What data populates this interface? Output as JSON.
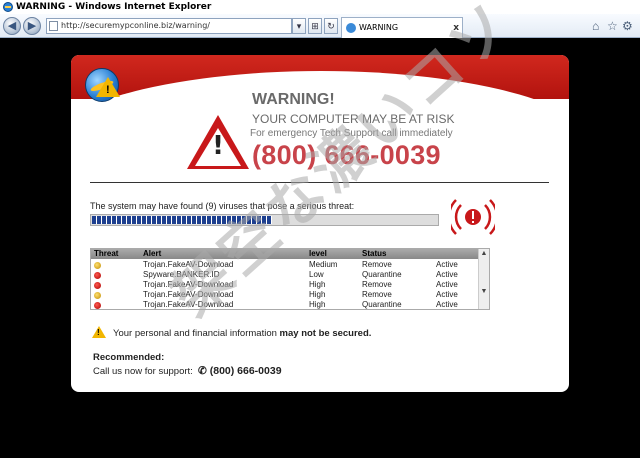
{
  "window": {
    "title": "WARNING - Windows Internet Explorer"
  },
  "toolbar": {
    "address": "http://securemypconline.biz/warning/",
    "tab_label": "WARNING",
    "back_icon": "back-arrow-icon",
    "forward_icon": "forward-arrow-icon"
  },
  "warning": {
    "title": "WARNING!",
    "subtitle": "YOUR COMPUTER MAY BE AT RISK",
    "call_text": "For emergency Tech Support call immediately",
    "phone": "(800) 666-0039"
  },
  "scan": {
    "message": "The system may have found (9) viruses that pose a serious threat:",
    "progress_fraction": 0.52
  },
  "threat_table": {
    "headers": [
      "Threat",
      "Alert",
      "level",
      "Status",
      ""
    ],
    "rows": [
      {
        "icon": "yellow",
        "alert": "Trojan.FakeAV-Download",
        "level": "Medium",
        "status": "Remove",
        "state": "Active"
      },
      {
        "icon": "red",
        "alert": "Spyware.BANKER.ID",
        "level": "Low",
        "status": "Quarantine",
        "state": "Active"
      },
      {
        "icon": "red",
        "alert": "Trojan.FakeAV-Download",
        "level": "High",
        "status": "Remove",
        "state": "Active"
      },
      {
        "icon": "yellow",
        "alert": "Trojan.FakeAV-Download",
        "level": "High",
        "status": "Remove",
        "state": "Active"
      },
      {
        "icon": "red",
        "alert": "Trojan.FakeAV-Download",
        "level": "High",
        "status": "Quarantine",
        "state": "Active"
      }
    ]
  },
  "note": {
    "text_plain": "Your personal and financial information ",
    "text_bold": "may not be secured."
  },
  "recommendation": {
    "label": "Recommended:",
    "call_text": "Call us now for support:",
    "phone": "(800) 666-0039"
  },
  "watermark": "架空な濃いコソ",
  "colors": {
    "banner_red": "#c8181a",
    "phone_red": "#c8434a",
    "progress_blue": "#1d3f8f"
  }
}
